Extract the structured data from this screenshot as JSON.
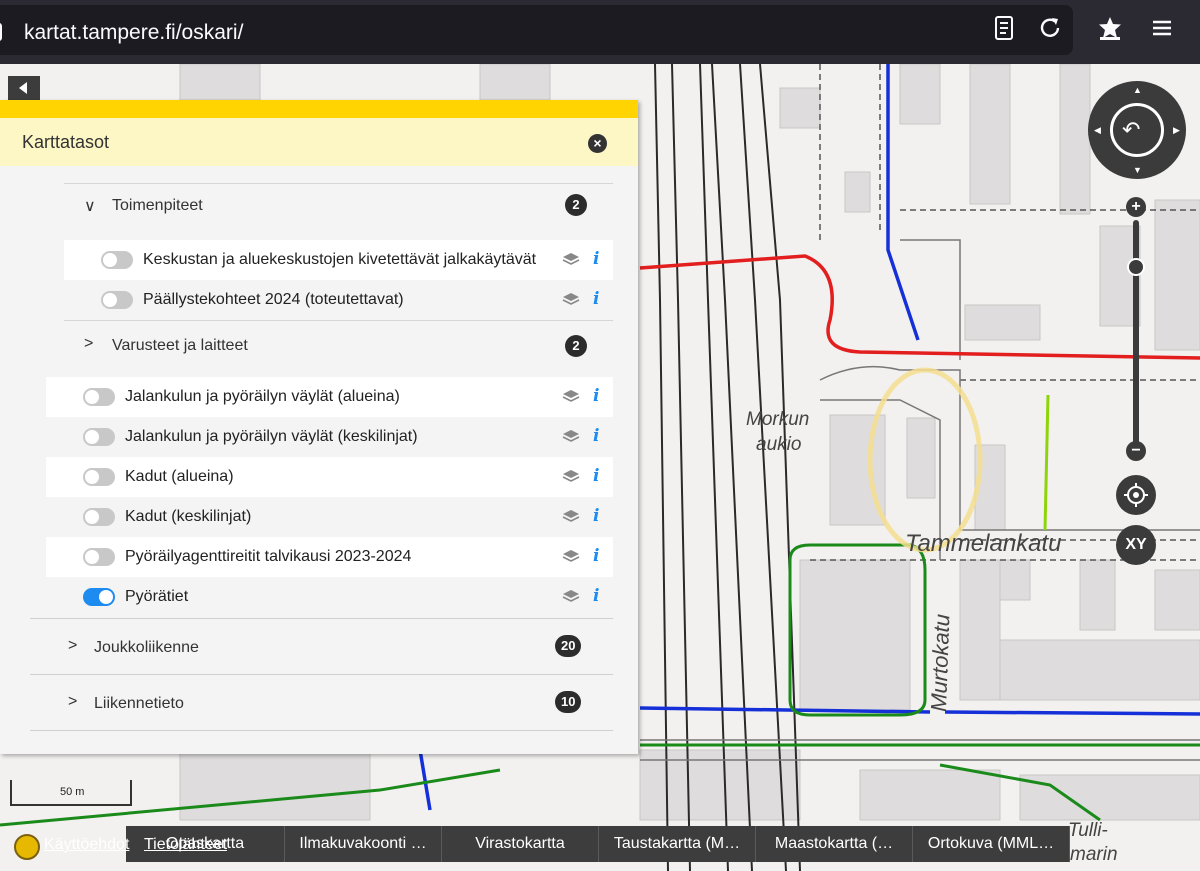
{
  "browser": {
    "url": "kartat.tampere.fi/oskari/",
    "icons": [
      "lock-icon",
      "reader-view-icon",
      "reload-icon",
      "bookmark-star-icon",
      "menu-icon"
    ]
  },
  "map_labels": {
    "morkun": "Morkun",
    "aukio": "aukio",
    "tammelankatu": "Tammelankatu",
    "murtokatu": "Murtokatu",
    "tulli": "Tulli-",
    "marin": "marin"
  },
  "panel": {
    "title": "Karttatasot",
    "subgroups": [
      {
        "label": "Toimenpiteet",
        "count": "2",
        "expanded": true
      },
      {
        "label": "Varusteet ja laitteet",
        "count": "2",
        "expanded": false
      }
    ],
    "toimenpiteet_layers": [
      {
        "label": "Keskustan ja aluekeskustojen kivetettävät jalkakäytävät",
        "on": false
      },
      {
        "label": "Päällystekohteet 2024 (toteutettavat)",
        "on": false
      }
    ],
    "layers": [
      {
        "label": "Jalankulun ja pyöräilyn väylät (alueina)",
        "on": false
      },
      {
        "label": "Jalankulun ja pyöräilyn väylät (keskilinjat)",
        "on": false
      },
      {
        "label": "Kadut (alueina)",
        "on": false
      },
      {
        "label": "Kadut (keskilinjat)",
        "on": false
      },
      {
        "label": "Pyöräilyagenttireitit talvikausi 2023-2024",
        "on": false
      },
      {
        "label": "Pyörätiet",
        "on": true
      }
    ],
    "groups": [
      {
        "label": "Joukkoliikenne",
        "count": "20"
      },
      {
        "label": "Liikennetieto",
        "count": "10"
      }
    ]
  },
  "controls": {
    "zoom_in": "+",
    "zoom_out": "−",
    "xy": "XY"
  },
  "scale": "50 m",
  "footer": {
    "links": [
      "Käyttöehdot",
      "Tietolähteet"
    ],
    "basemap_tabs": [
      "Opaskartta",
      "Ilmakuvakoonti …",
      "Virastokartta",
      "Taustakartta (M…",
      "Maastokartta (…",
      "Ortokuva (MML…"
    ]
  }
}
